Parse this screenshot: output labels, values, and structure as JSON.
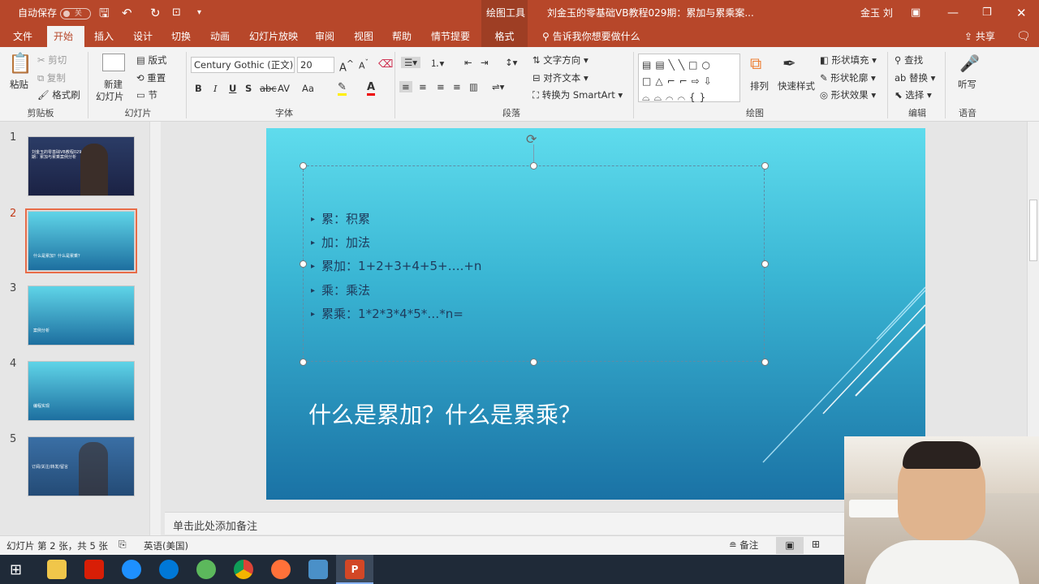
{
  "titlebar": {
    "autosave_label": "自动保存",
    "autosave_state": "关",
    "context_tool": "绘图工具",
    "doc_title": "刘金玉的零基础VB教程029期：累加与累乘案...",
    "user": "金玉 刘"
  },
  "tabs": [
    "文件",
    "开始",
    "插入",
    "设计",
    "切换",
    "动画",
    "幻灯片放映",
    "审阅",
    "视图",
    "帮助",
    "情节提要",
    "格式"
  ],
  "tell_me": "告诉我你想要做什么",
  "share": "共享",
  "ribbon": {
    "clipboard": {
      "paste": "粘贴",
      "cut": "剪切",
      "copy": "复制",
      "format_painter": "格式刷",
      "label": "剪贴板"
    },
    "slides": {
      "new_slide_1": "新建",
      "new_slide_2": "幻灯片",
      "layout": "版式",
      "reset": "重置",
      "section": "节",
      "label": "幻灯片"
    },
    "font": {
      "family": "Century Gothic (正文)",
      "size": "20",
      "label": "字体",
      "bold": "B",
      "italic": "I",
      "underline": "U",
      "shadow": "S",
      "strike": "abc",
      "spacing": "AV",
      "case": "Aa"
    },
    "paragraph": {
      "text_direction": "文字方向",
      "align_text": "对齐文本",
      "smartart": "转换为 SmartArt",
      "label": "段落"
    },
    "drawing": {
      "arrange": "排列",
      "quick_styles": "快速样式",
      "fill": "形状填充",
      "outline": "形状轮廓",
      "effects": "形状效果",
      "label": "绘图"
    },
    "editing": {
      "find": "查找",
      "replace": "替换",
      "select": "选择",
      "label": "编辑"
    },
    "voice": {
      "dictate": "听写",
      "label": "语音"
    }
  },
  "thumbnails": [
    {
      "num": "1",
      "text": "刘金玉的零基础VB教程029期：累加与累乘案例分析"
    },
    {
      "num": "2",
      "text": "什么是累加？什么是累乘？"
    },
    {
      "num": "3",
      "text": "案例分析"
    },
    {
      "num": "4",
      "text": "编程实现"
    },
    {
      "num": "5",
      "text": "订阅/关注/转发/留言"
    }
  ],
  "slide": {
    "bullets": [
      "累：积累",
      "加：加法",
      "累加：1+2+3+4+5+….+n",
      "乘：乘法",
      "累乘：1*2*3*4*5*…*n="
    ],
    "title": "什么是累加？什么是累乘？"
  },
  "notes_placeholder": "单击此处添加备注",
  "status": {
    "slide_info": "幻灯片 第 2 张，共 5 张",
    "language": "英语(美国)",
    "notes": "备注"
  },
  "colors": {
    "accent": "#b7472a",
    "slide_top": "#5fdced",
    "slide_bottom": "#1a72a5"
  }
}
